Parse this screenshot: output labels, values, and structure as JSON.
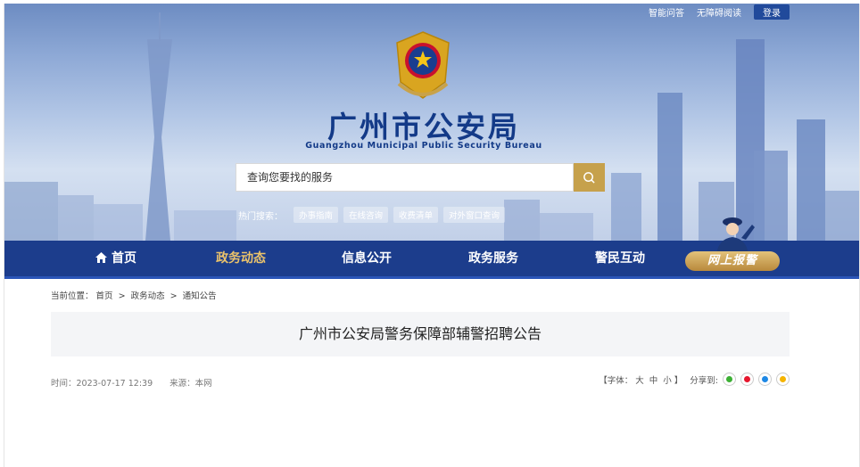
{
  "header": {
    "top_links": {
      "qa": "智能问答",
      "accessibility": "无障碍阅读",
      "login": "登录"
    },
    "title_cn": "广州市公安局",
    "title_en": "Guangzhou Municipal Public Security Bureau",
    "search": {
      "placeholder": "查询您要找的服务"
    },
    "hot": {
      "label": "热门搜索：",
      "tags": [
        "办事指南",
        "在线咨询",
        "收费清单",
        "对外窗口查询"
      ]
    }
  },
  "nav": {
    "items": [
      "首页",
      "政务动态",
      "信息公开",
      "政务服务",
      "警民互动"
    ],
    "active": "政务动态",
    "report": "网上报警"
  },
  "breadcrumb": {
    "label": "当前位置：",
    "items": [
      "首页",
      "政务动态",
      "通知公告"
    ],
    "sep": ">"
  },
  "article": {
    "title": "广州市公安局警务保障部辅警招聘公告",
    "time": "时间：2023-07-17 12:39",
    "source": "来源：本网",
    "font_label": "【字体：",
    "font_sizes": [
      "大",
      "中",
      "小"
    ],
    "font_end": "】",
    "share_label": "分享到:",
    "share_icons": [
      "wechat-icon",
      "weibo-icon",
      "qq-icon",
      "qzone-icon"
    ]
  },
  "colors": {
    "nav_bg": "#1c3d8c",
    "accent_gold": "#c6a14c",
    "title_blue": "#133a88"
  }
}
